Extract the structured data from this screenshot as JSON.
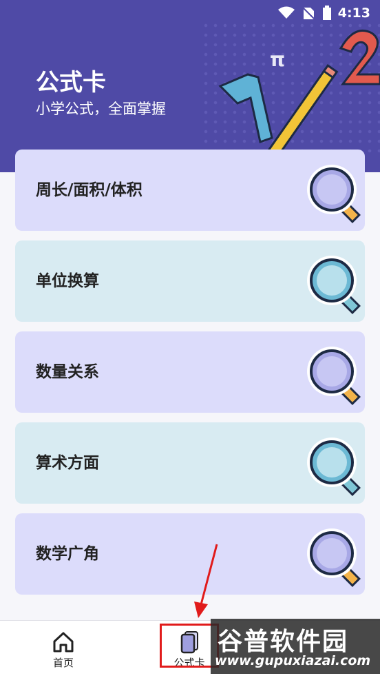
{
  "status_bar": {
    "time": "4:13"
  },
  "header": {
    "title": "公式卡",
    "subtitle": "小学公式，全面掌握"
  },
  "cards": [
    {
      "label": "周长/面积/体积",
      "color": "#dcdcfb",
      "icon": "magnifier-icon"
    },
    {
      "label": "单位换算",
      "color": "#d8ebf2",
      "icon": "magnifier-icon"
    },
    {
      "label": "数量关系",
      "color": "#dcdcfb",
      "icon": "magnifier-icon"
    },
    {
      "label": "算术方面",
      "color": "#d8ebf2",
      "icon": "magnifier-icon"
    },
    {
      "label": "数学广角",
      "color": "#dcdcfb",
      "icon": "magnifier-icon"
    }
  ],
  "tabs": [
    {
      "label": "首页",
      "icon": "home-icon"
    },
    {
      "label": "公式卡",
      "icon": "card-icon",
      "active": true
    }
  ],
  "watermark": {
    "line1": "谷普软件园",
    "line2": "www.gupuxiazai.com"
  },
  "colors": {
    "header": "#4f4aa6",
    "accent": "#7f7fd0",
    "highlight": "#e11b1b"
  }
}
